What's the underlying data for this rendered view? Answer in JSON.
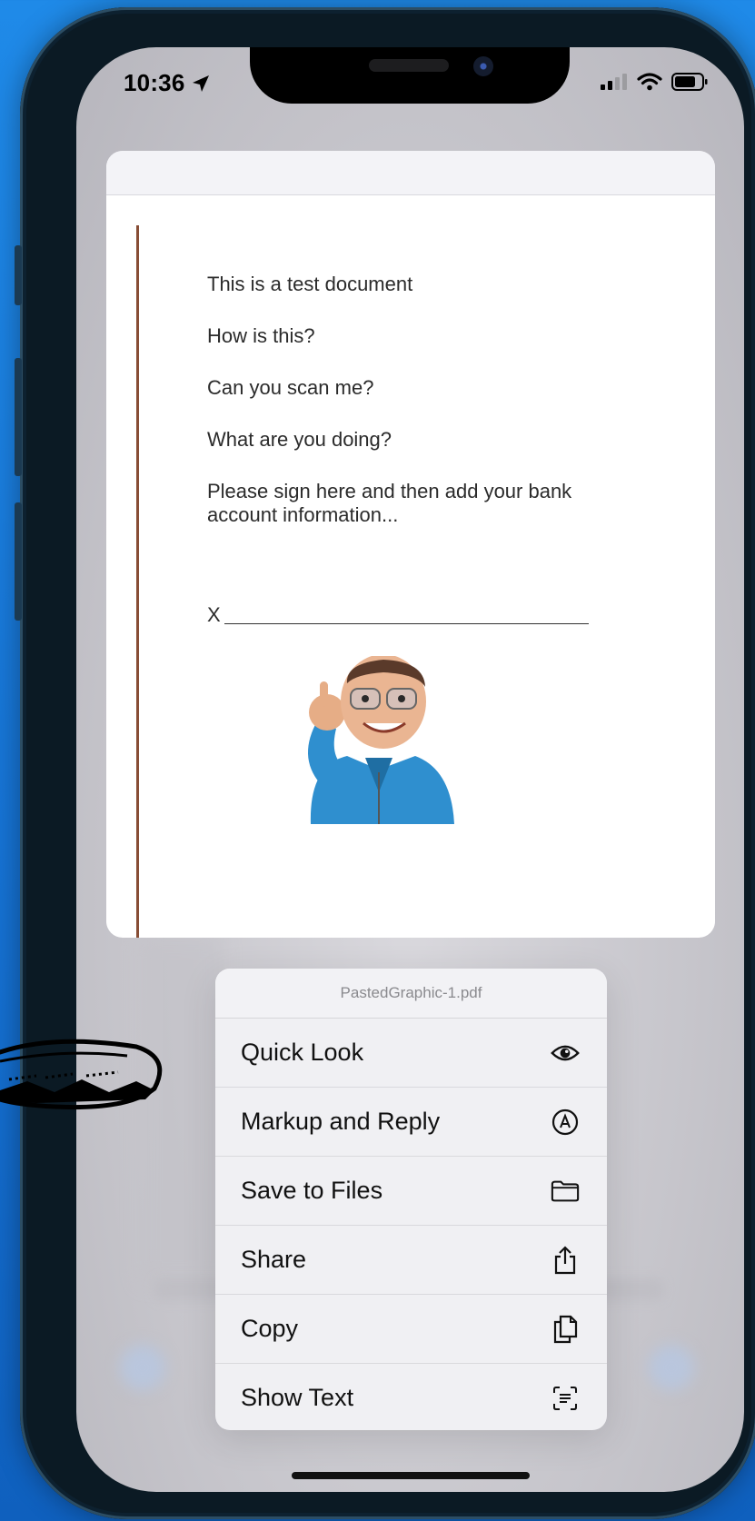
{
  "status_bar": {
    "time": "10:36"
  },
  "document": {
    "lines": [
      "This is a test document",
      "How is this?",
      "Can you scan me?",
      "What are you doing?",
      "Please sign here and then add your bank account information..."
    ],
    "signature_prefix": "X"
  },
  "menu": {
    "title": "PastedGraphic-1.pdf",
    "items": [
      {
        "label": "Quick Look",
        "icon": "eye-icon"
      },
      {
        "label": "Markup and Reply",
        "icon": "markup-icon"
      },
      {
        "label": "Save to Files",
        "icon": "folder-icon"
      },
      {
        "label": "Share",
        "icon": "share-icon"
      },
      {
        "label": "Copy",
        "icon": "copy-icon"
      },
      {
        "label": "Show Text",
        "icon": "text-scan-icon"
      }
    ]
  },
  "colors": {
    "background": "#1a7fe0",
    "menu_bg": "#f0f0f3",
    "doc_margin_line": "#7a3a1f"
  }
}
